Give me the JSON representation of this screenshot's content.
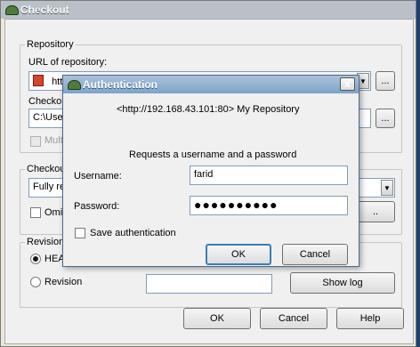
{
  "checkout": {
    "title": "Checkout",
    "repository_group": "Repository",
    "url_label": "URL of repository:",
    "url_value": "htt",
    "checkout_dir_label": "Checkou",
    "checkout_dir_value": "C:\\Use",
    "browse_label": "...",
    "multi_label": "Multi",
    "depth_group": "Checkou",
    "depth_value": "Fully re",
    "omit_label": "Omit",
    "revision_group": "Revision",
    "head_label": "HEA",
    "revision_label": "Revision",
    "show_log": "Show log",
    "ok": "OK",
    "cancel": "Cancel",
    "help": "Help"
  },
  "auth": {
    "title": "Authentication",
    "realm": "<http://192.168.43.101:80> My Repository",
    "prompt": "Requests a username and a password",
    "username_label": "Username:",
    "username_value": "farid",
    "password_label": "Password:",
    "password_value": "●●●●●●●●●●",
    "save_label": "Save authentication",
    "close": "x",
    "ok": "OK",
    "cancel": "Cancel"
  },
  "icons": {
    "app": "tortoise-icon",
    "repo": "repository-icon",
    "dropdown": "chevron-down-icon"
  }
}
